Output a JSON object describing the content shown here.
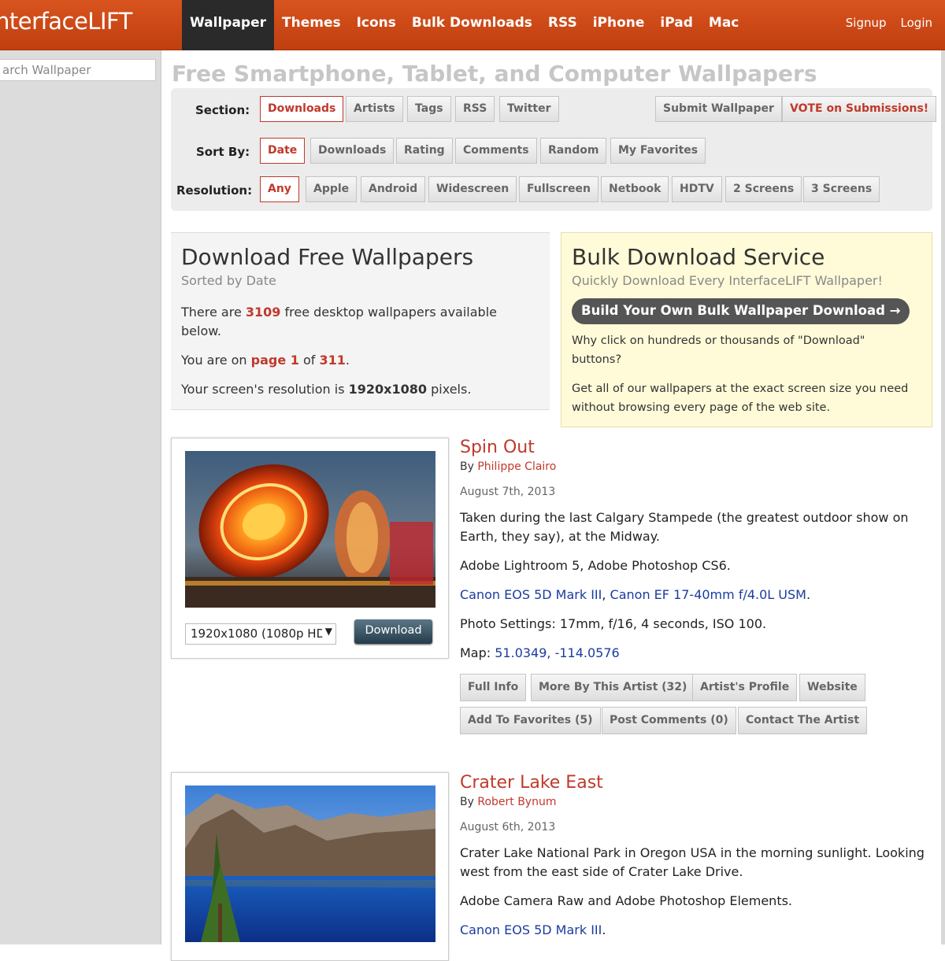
{
  "site": {
    "logo": "nterfaceLIFT"
  },
  "nav": {
    "items": [
      "Wallpaper",
      "Themes",
      "Icons",
      "Bulk Downloads",
      "RSS",
      "iPhone",
      "iPad",
      "Mac"
    ],
    "active": "Wallpaper"
  },
  "auth": {
    "signup": "Signup",
    "login": "Login"
  },
  "sidebar": {
    "search_placeholder": "arch Wallpaper"
  },
  "page_title": "Free Smartphone, Tablet, and Computer Wallpapers",
  "filters": {
    "section_label": "Section:",
    "section": [
      "Downloads",
      "Artists",
      "Tags",
      "RSS",
      "Twitter"
    ],
    "submit": "Submit Wallpaper",
    "vote": "VOTE on Submissions!",
    "sort_label": "Sort By:",
    "sort": [
      "Date",
      "Downloads",
      "Rating",
      "Comments",
      "Random",
      "My Favorites"
    ],
    "resolution_label": "Resolution:",
    "resolution": [
      "Any",
      "Apple",
      "Android",
      "Widescreen",
      "Fullscreen",
      "Netbook",
      "HDTV",
      "2 Screens",
      "3 Screens"
    ]
  },
  "info": {
    "title": "Download Free Wallpapers",
    "subtitle": "Sorted by Date",
    "count_pre": "There are ",
    "count": "3109",
    "count_post": " free desktop wallpapers available below.",
    "page_pre": "You are on ",
    "page_link": "page 1",
    "page_mid": " of ",
    "page_total": "311",
    "page_post": ".",
    "res_pre": "Your screen's resolution is ",
    "res": "1920x1080",
    "res_post": " pixels."
  },
  "bulk": {
    "title": "Bulk Download Service",
    "subtitle": "Quickly Download Every InterfaceLIFT Wallpaper!",
    "button": "Build Your Own Bulk Wallpaper Download →",
    "p1": "Why click on hundreds or thousands of \"Download\" buttons?",
    "p2": "Get all of our wallpapers at the exact screen size you need without browsing every page of the web site."
  },
  "wallpapers": [
    {
      "title": "Spin Out",
      "by": "By ",
      "artist": "Philippe Clairo",
      "date": "August 7th, 2013",
      "desc": "Taken during the last Calgary Stampede (the greatest outdoor show on Earth, they say), at the Midway.",
      "software": "Adobe Lightroom 5, Adobe Photoshop CS6.",
      "camera": "Canon EOS 5D Mark III",
      "lens": "Canon EF 17-40mm f/4.0L USM",
      "settings": "Photo Settings: 17mm, f/16, 4 seconds, ISO 100.",
      "map_label": "Map: ",
      "map": "51.0349, -114.0576",
      "resolution": "1920x1080 (1080p HD",
      "download": "Download",
      "actions1": [
        "Full Info",
        "More By This Artist (32)",
        "Artist's Profile",
        "Website"
      ],
      "actions2": [
        "Add To Favorites (5)",
        "Post Comments (0)",
        "Contact The Artist"
      ]
    },
    {
      "title": "Crater Lake East",
      "by": "By ",
      "artist": "Robert Bynum",
      "date": "August 6th, 2013",
      "desc": "Crater Lake National Park in Oregon USA in the morning sunlight. Looking west from the east side of Crater Lake Drive.",
      "software": "Adobe Camera Raw and Adobe Photoshop Elements.",
      "camera": "Canon EOS 5D Mark III"
    }
  ]
}
